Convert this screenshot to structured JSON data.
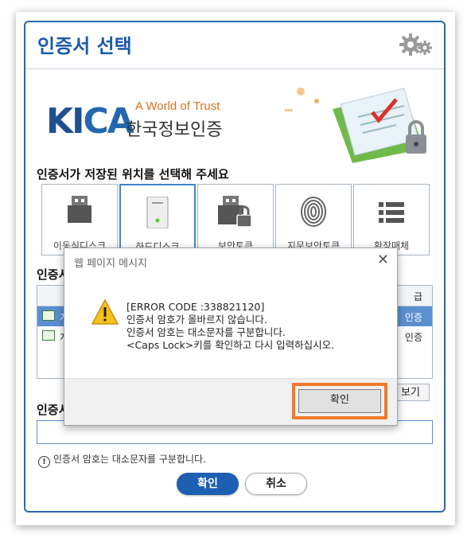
{
  "window": {
    "title": "인증서 선택"
  },
  "logo": {
    "brand": "KICA",
    "tagline": "A World of Trust",
    "org_name": "한국정보인증"
  },
  "storage": {
    "heading": "인증서가 저장된 위치를 선택해 주세요",
    "items": [
      {
        "label": "이동식디스크",
        "icon": "usb-drive-icon"
      },
      {
        "label": "하드디스크",
        "icon": "hard-disk-icon"
      },
      {
        "label": "보안토큰",
        "icon": "security-token-icon"
      },
      {
        "label": "지문보안토큰",
        "icon": "fingerprint-icon"
      },
      {
        "label": "확장매체",
        "icon": "list-icon"
      }
    ]
  },
  "cert_section": {
    "heading_partial": "인증서",
    "header_right": "급",
    "rows": [
      {
        "name_partial": "개",
        "issuer_partial": "인증"
      },
      {
        "name_partial": "개",
        "issuer_partial": "인증"
      }
    ],
    "view_button": "보기"
  },
  "password": {
    "heading_partial": "인증서",
    "hint": "인증서 암호는 대소문자를 구분합니다."
  },
  "buttons": {
    "ok": "확인",
    "cancel": "취소"
  },
  "modal": {
    "title": "웹 페이지 메시지",
    "lines": [
      "[ERROR CODE :338821120]",
      "인증서 암호가 올바르지 않습니다.",
      "인증서 암호는 대소문자를 구분합니다.",
      "<Caps Lock>키를 확인하고 다시 입력하십시오."
    ],
    "ok_label": "확인"
  },
  "colors": {
    "accent": "#1a5aa7",
    "highlight": "#f07a2a",
    "selected_row": "#5b8fd0"
  }
}
